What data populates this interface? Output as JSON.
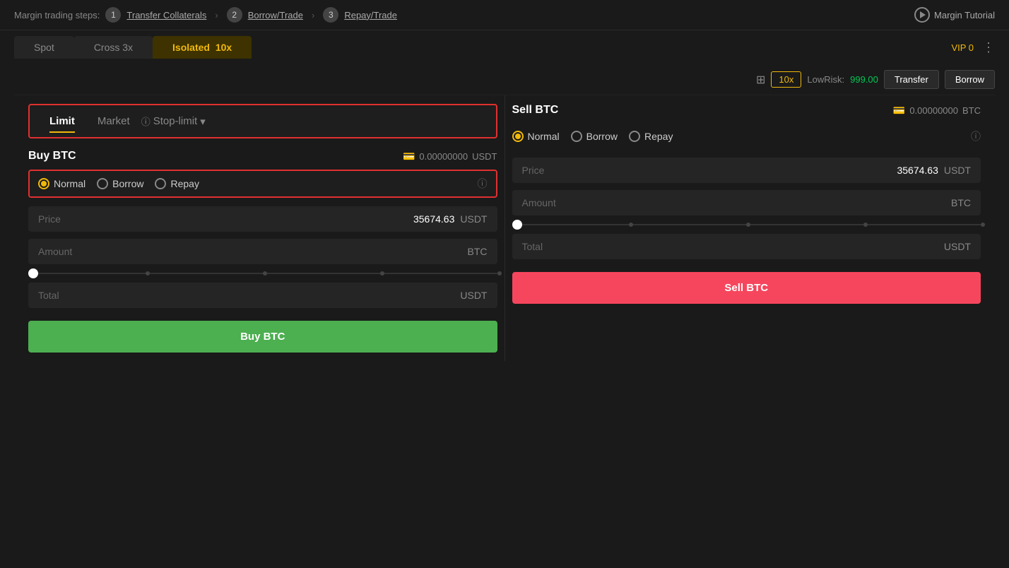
{
  "topBar": {
    "label": "Margin trading steps:",
    "step1Num": "1",
    "step1Link": "Transfer Collaterals",
    "step2Num": "2",
    "step2Link": "Borrow/Trade",
    "step3Num": "3",
    "step3Link": "Repay/Trade",
    "tutorialLabel": "Margin Tutorial"
  },
  "tabs": {
    "spot": "Spot",
    "cross": "Cross 3x",
    "isolated": "Isolated",
    "isolatedBadge": "10x",
    "vip": "VIP 0"
  },
  "toolbar": {
    "leverage": "10x",
    "lowRiskLabel": "LowRisk:",
    "lowRiskValue": "999.00",
    "transferLabel": "Transfer",
    "borrowLabel": "Borrow"
  },
  "orderTypes": {
    "limit": "Limit",
    "market": "Market",
    "stopLimit": "Stop-limit"
  },
  "buyPanel": {
    "title": "Buy BTC",
    "balance": "0.00000000",
    "balanceUnit": "USDT",
    "radioNormal": "Normal",
    "radioBorrow": "Borrow",
    "radioRepay": "Repay",
    "priceLabel": "Price",
    "priceValue": "35674.63",
    "priceUnit": "USDT",
    "amountLabel": "Amount",
    "amountUnit": "BTC",
    "totalLabel": "Total",
    "totalUnit": "USDT",
    "btnLabel": "Buy BTC"
  },
  "sellPanel": {
    "title": "Sell BTC",
    "balance": "0.00000000",
    "balanceUnit": "BTC",
    "radioNormal": "Normal",
    "radioBorrow": "Borrow",
    "radioRepay": "Repay",
    "priceLabel": "Price",
    "priceValue": "35674.63",
    "priceUnit": "USDT",
    "amountLabel": "Amount",
    "amountUnit": "BTC",
    "totalLabel": "Total",
    "totalUnit": "USDT",
    "btnLabel": "Sell BTC"
  },
  "colors": {
    "accent": "#f0b90b",
    "buy": "#4caf50",
    "sell": "#f6465d",
    "highlight": "#e03030"
  }
}
